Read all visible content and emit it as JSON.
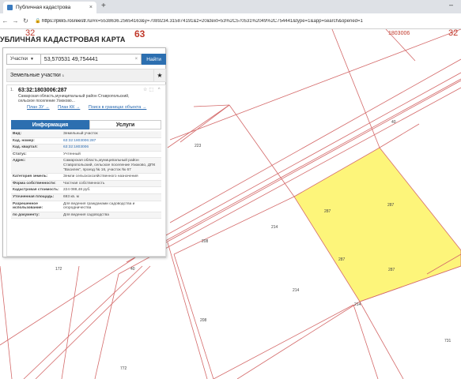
{
  "browser": {
    "tab_title": "Публичная кадастрова",
    "tab_close": "×",
    "new_tab": "+",
    "win_min": "–",
    "nav_back": "←",
    "nav_forward": "→",
    "nav_reload": "↻",
    "url_host": "https://pkk5.rosreestr.ru",
    "url_rest": "/#x=5538636.25654163&y=7089234.315874191&z=20&text=53%2C570531%2049%2C754441&type=1&app=search&opened=1"
  },
  "map": {
    "header": "УБЛИЧНАЯ КАДАСТРОВАЯ КАРТА",
    "zone_labels": {
      "left_32": "32",
      "center_63": "63",
      "right_32": "32",
      "block_1803006": "1803006"
    },
    "parcel_labels": {
      "p223": "223",
      "p40a": "40",
      "p214a": "214",
      "p208a": "208",
      "p208b": "208",
      "p214b": "214",
      "p172": "172",
      "p40b": "40",
      "p772": "772",
      "p731": "731",
      "p214c": "214",
      "p287a": "287",
      "p287b": "287",
      "p287c": "287",
      "p287d": "287"
    },
    "highlight_color": "#fdf57a",
    "line_color": "#d46a6a"
  },
  "panel": {
    "search_type": "Участки",
    "search_value": "53,570531 49,754441",
    "search_clear": "×",
    "search_button": "Найти",
    "layer_title": "Земельные участки",
    "layer_count": "1",
    "star": "★",
    "card": {
      "num": "1.",
      "id": "63:32:1803006:287",
      "address": "Самарская область,муниципальный район Ставропольский, сельское поселение Узюково...",
      "tools": "☆⬚ ^",
      "links": [
        "План ЗУ →",
        "План КК →",
        "Поиск в границах объекта →"
      ],
      "tab_info": "Информация",
      "tab_services": "Услуги",
      "rows": [
        {
          "key": "Вид:",
          "val": "Земельный участок",
          "link": false
        },
        {
          "key": "Кад. номер:",
          "val": "63:32:1803006:287",
          "link": true
        },
        {
          "key": "Кад. квартал:",
          "val": "63:32:1803006",
          "link": true
        },
        {
          "key": "Статус:",
          "val": "Учтенный",
          "link": false
        },
        {
          "key": "Адрес:",
          "val": "Самарская область,муниципальный район Ставропольский, сельское поселение Узюково, ДПК \"Василек\", проезд № 16, участок № 67",
          "link": false
        },
        {
          "key": "Категория земель:",
          "val": "Земли сельскохозяйственного назначения",
          "link": false
        },
        {
          "key": "Форма собственности:",
          "val": "Частная собственность",
          "link": false
        },
        {
          "key": "Кадастровая стоимость:",
          "val": "224 088,48 руб.",
          "link": false
        },
        {
          "key": "Уточненная площадь:",
          "val": "693 кв. м",
          "link": false
        },
        {
          "key": "Разрешенное использование:",
          "val": "Для ведения гражданами садоводства и огородничества",
          "link": false
        },
        {
          "key": "по документу:",
          "val": "Для ведения садоводства",
          "link": false
        }
      ]
    }
  }
}
